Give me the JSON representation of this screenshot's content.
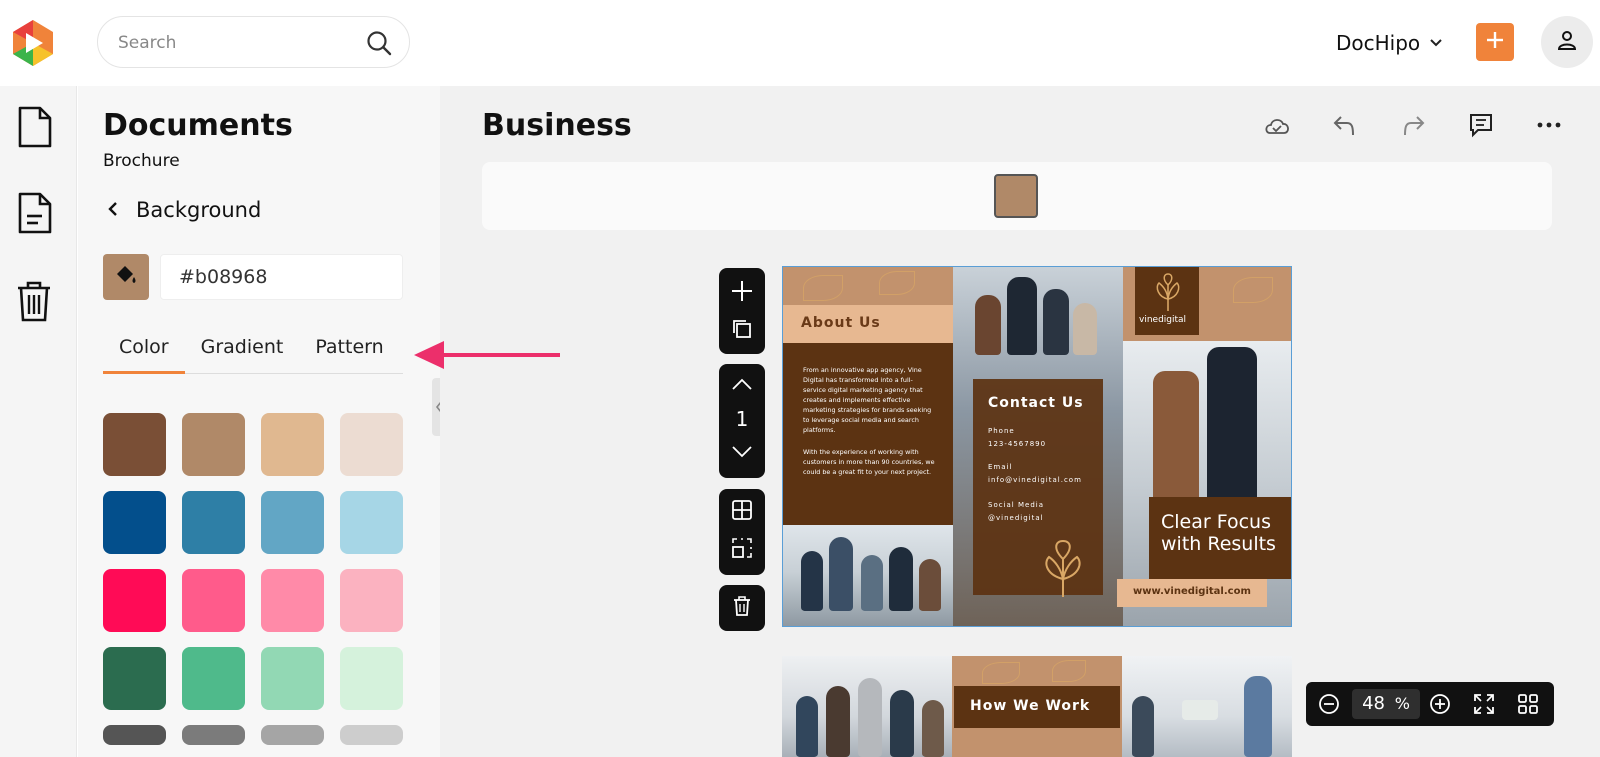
{
  "topbar": {
    "search_placeholder": "Search",
    "brand_label": "DocHipo",
    "icons": [
      "app-logo",
      "search-icon",
      "chevron-down-icon",
      "plus-icon",
      "user-icon"
    ]
  },
  "rail": {
    "items": [
      {
        "name": "documents",
        "icon": "document-icon"
      },
      {
        "name": "templates",
        "icon": "file-text-icon"
      },
      {
        "name": "trash",
        "icon": "trash-icon"
      }
    ]
  },
  "panel": {
    "title": "Documents",
    "subtitle": "Brochure",
    "back_label": "Background",
    "hex_value": "#b08968",
    "tabs": [
      {
        "label": "Color",
        "active": true
      },
      {
        "label": "Gradient",
        "active": false
      },
      {
        "label": "Pattern",
        "active": false
      }
    ],
    "swatches": [
      [
        "#7a4f36",
        "#b08968",
        "#e0b890",
        "#ecdcd2"
      ],
      [
        "#034f8c",
        "#2e7fa6",
        "#62a6c5",
        "#a6d6e6"
      ],
      [
        "#ff0b56",
        "#ff5b8b",
        "#ff8aa8",
        "#fbb2c0"
      ],
      [
        "#2b6c4f",
        "#4fba8b",
        "#92d8b4",
        "#d5f2dc"
      ],
      [
        "#555555",
        "#7b7b7b",
        "#a5a5a5",
        "#cdcdcd"
      ]
    ]
  },
  "main": {
    "doc_title": "Business",
    "toolbar_icons": [
      "cloud-sync-icon",
      "undo-icon",
      "redo-icon",
      "comment-icon",
      "more-icon"
    ],
    "strip_color": "#b08968",
    "page_number": "1",
    "zoom": {
      "value": "48",
      "unit": "%"
    }
  },
  "brochure": {
    "about_heading": "About Us",
    "about_p1": "From an innovative app agency, Vine Digital has transformed into a full-service digital marketing agency that creates and implements effective marketing strategies for brands seeking to leverage social media and search platforms.",
    "about_p2": "With the experience of working with customers in more than 90 countries, we could be a great fit to your next project.",
    "contact_heading": "Contact Us",
    "phone_label": "Phone",
    "phone_value": "123-4567890",
    "email_label": "Email",
    "email_value": "info@vinedigital.com",
    "social_label": "Social Media",
    "social_value": "@vinedigital",
    "brand_name": "vinedigital",
    "tagline_line1": "Clear Focus",
    "tagline_line2": "with Results",
    "website": "www.vinedigital.com",
    "how_heading": "How We Work"
  }
}
